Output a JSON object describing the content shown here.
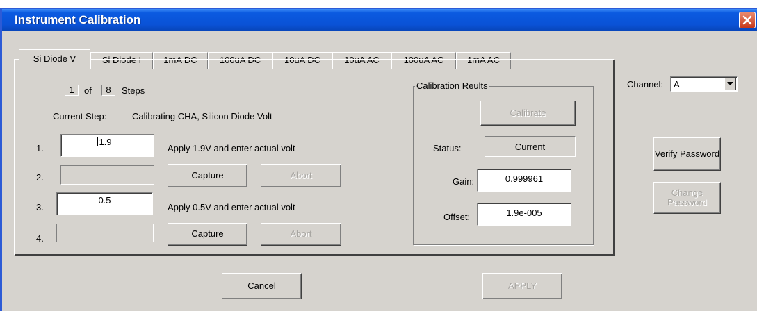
{
  "window": {
    "title": "Instrument Calibration"
  },
  "tabs": [
    {
      "label": "Si Diode V",
      "active": true
    },
    {
      "label": "Si Diode I"
    },
    {
      "label": "1mA DC"
    },
    {
      "label": "100uA DC"
    },
    {
      "label": "10uA DC"
    },
    {
      "label": "10uA AC"
    },
    {
      "label": "100uA AC"
    },
    {
      "label": "1mA AC"
    }
  ],
  "steps": {
    "current": "1",
    "of_label": "of",
    "total": "8",
    "steps_label": "Steps"
  },
  "current_step": {
    "label": "Current Step:",
    "value": "Calibrating CHA, Silicon Diode Volt"
  },
  "rows": [
    {
      "num": "1.",
      "value": "1.9",
      "instruction": "Apply 1.9V and enter actual volt"
    },
    {
      "num": "2.",
      "value": "",
      "capture": "Capture",
      "abort": "Abort"
    },
    {
      "num": "3.",
      "value": "0.5",
      "instruction": "Apply 0.5V and enter actual volt"
    },
    {
      "num": "4.",
      "value": "",
      "capture": "Capture",
      "abort": "Abort"
    }
  ],
  "results": {
    "title": "Calibration Reults",
    "calibrate": "Calibrate",
    "status_label": "Status:",
    "status_value": "Current",
    "gain_label": "Gain:",
    "gain_value": "0.999961",
    "offset_label": "Offset:",
    "offset_value": "1.9e-005"
  },
  "channel": {
    "label": "Channel:",
    "value": "A"
  },
  "password": {
    "verify": "Verify Password",
    "change": "Change Password"
  },
  "footer": {
    "cancel": "Cancel",
    "apply": "APPLY"
  },
  "colors": {
    "titlebar": "#0a52d6",
    "close": "#c8381a",
    "face": "#d6d3ce"
  }
}
